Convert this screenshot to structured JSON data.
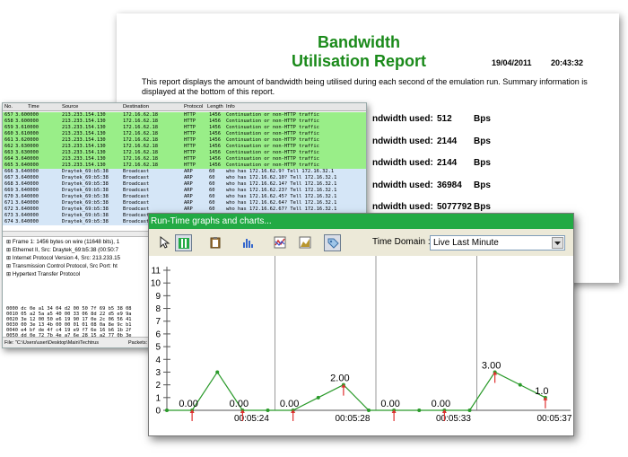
{
  "report": {
    "title_line1": "Bandwidth",
    "title_line2": "Utilisation Report",
    "date": "19/04/2011",
    "time": "20:43:32",
    "intro": "This report displays the amount of bandwidth being utilised during each second of the emulation run.  Summary information is displayed at the bottom of this report.",
    "rows": [
      {
        "label": "ndwidth used:",
        "value": "512",
        "unit": "Bps"
      },
      {
        "label": "ndwidth used:",
        "value": "2144",
        "unit": "Bps"
      },
      {
        "label": "ndwidth used:",
        "value": "2144",
        "unit": "Bps"
      },
      {
        "label": "ndwidth used:",
        "value": "36984",
        "unit": "Bps"
      },
      {
        "label": "ndwidth used:",
        "value": "5077792",
        "unit": "Bps"
      }
    ]
  },
  "capture": {
    "columns": [
      "No.",
      "Time",
      "Source",
      "Destination",
      "Protocol",
      "Length",
      "Info"
    ],
    "packets": [
      {
        "no": "657",
        "time": "3.600000",
        "src": "213.233.154.130",
        "dst": "172.16.62.18",
        "proto": "HTTP",
        "len": "1456",
        "info": "Continuation or non-HTTP traffic",
        "kind": "http"
      },
      {
        "no": "658",
        "time": "3.600000",
        "src": "213.233.154.130",
        "dst": "172.16.62.18",
        "proto": "HTTP",
        "len": "1456",
        "info": "Continuation or non-HTTP traffic",
        "kind": "http"
      },
      {
        "no": "659",
        "time": "3.610000",
        "src": "213.233.154.130",
        "dst": "172.16.62.18",
        "proto": "HTTP",
        "len": "1456",
        "info": "Continuation or non-HTTP traffic",
        "kind": "http"
      },
      {
        "no": "660",
        "time": "3.610000",
        "src": "213.233.154.130",
        "dst": "172.16.62.18",
        "proto": "HTTP",
        "len": "1456",
        "info": "Continuation or non-HTTP traffic",
        "kind": "http"
      },
      {
        "no": "661",
        "time": "3.620000",
        "src": "213.233.154.130",
        "dst": "172.16.62.18",
        "proto": "HTTP",
        "len": "1456",
        "info": "Continuation or non-HTTP traffic",
        "kind": "http"
      },
      {
        "no": "662",
        "time": "3.630000",
        "src": "213.233.154.130",
        "dst": "172.16.62.18",
        "proto": "HTTP",
        "len": "1456",
        "info": "Continuation or non-HTTP traffic",
        "kind": "http"
      },
      {
        "no": "663",
        "time": "3.630000",
        "src": "213.233.154.130",
        "dst": "172.16.62.18",
        "proto": "HTTP",
        "len": "1456",
        "info": "Continuation or non-HTTP traffic",
        "kind": "http"
      },
      {
        "no": "664",
        "time": "3.640000",
        "src": "213.233.154.130",
        "dst": "172.16.62.18",
        "proto": "HTTP",
        "len": "1456",
        "info": "Continuation or non-HTTP traffic",
        "kind": "http"
      },
      {
        "no": "665",
        "time": "3.640000",
        "src": "213.233.154.130",
        "dst": "172.16.62.18",
        "proto": "HTTP",
        "len": "1456",
        "info": "Continuation or non-HTTP traffic",
        "kind": "http"
      },
      {
        "no": "666",
        "time": "3.640000",
        "src": "Draytek_69:b5:38",
        "dst": "Broadcast",
        "proto": "ARP",
        "len": "60",
        "info": "who has 172.16.62.9?  Tell 172.16.32.1",
        "kind": "arp"
      },
      {
        "no": "667",
        "time": "3.640000",
        "src": "Draytek_69:b5:38",
        "dst": "Broadcast",
        "proto": "ARP",
        "len": "60",
        "info": "who has 172.16.62.10?  Tell 172.16.32.1",
        "kind": "arp"
      },
      {
        "no": "668",
        "time": "3.640000",
        "src": "Draytek_69:b5:38",
        "dst": "Broadcast",
        "proto": "ARP",
        "len": "60",
        "info": "who has 172.16.62.14?  Tell 172.16.32.1",
        "kind": "arp"
      },
      {
        "no": "669",
        "time": "3.640000",
        "src": "Draytek_69:b5:38",
        "dst": "Broadcast",
        "proto": "ARP",
        "len": "60",
        "info": "who has 172.16.62.23?  Tell 172.16.32.1",
        "kind": "arp"
      },
      {
        "no": "670",
        "time": "3.640000",
        "src": "Draytek_69:b5:38",
        "dst": "Broadcast",
        "proto": "ARP",
        "len": "60",
        "info": "who has 172.16.62.45?  Tell 172.16.32.1",
        "kind": "arp"
      },
      {
        "no": "671",
        "time": "3.640000",
        "src": "Draytek_69:b5:38",
        "dst": "Broadcast",
        "proto": "ARP",
        "len": "60",
        "info": "who has 172.16.62.64?  Tell 172.16.32.1",
        "kind": "arp"
      },
      {
        "no": "672",
        "time": "3.640000",
        "src": "Draytek_69:b5:38",
        "dst": "Broadcast",
        "proto": "ARP",
        "len": "60",
        "info": "who has 172.16.62.67?  Tell 172.16.32.1",
        "kind": "arp"
      },
      {
        "no": "673",
        "time": "3.640000",
        "src": "Draytek_69:b5:38",
        "dst": "Broadcast",
        "proto": "ARP",
        "len": "60",
        "info": "who has 172.16.62.",
        "kind": "arp"
      },
      {
        "no": "674",
        "time": "3.640000",
        "src": "Draytek_69:b5:38",
        "dst": "Broadcast",
        "proto": "ARP",
        "len": "60",
        "info": "who has",
        "kind": "arp"
      }
    ],
    "details": [
      "Frame 1: 1456 bytes on wire (11648 bits), 1",
      "Ethernet II, Src: Draytek_69:b5:38 (00:50:7",
      "Internet Protocol Version 4, Src: 213.233.15",
      "Transmission Control Protocol, Src Port: ht",
      "Hypertext Transfer Protocol"
    ],
    "hex": [
      "0000  dc 0e a1 34 04 d2 00 50  7f 69 b5 38 08",
      "0010  05 a2 5a a5 40 00 33 06  8d 22 d5 e9 9a",
      "0020  3e 12 00 50 e6 19 90 17  0e 2c 06 56 41",
      "0030  00 3e 13 4b 00 00 01 01  08 0a 8e 9c b1",
      "0040  e4 bf de 4f c4 19 e9 f7  6e 16 b6 1b 2f",
      "0050  dd 0e 72 7b 4e a7 6e 28  15 a2 77 0b 3e"
    ],
    "status_file": "File: \"C:\\Users\\user\\Desktop\\Main\\Techtrus",
    "status_packets": "Packets: 2983 D"
  },
  "graph": {
    "window_title": "Run-Time graphs and charts...",
    "time_domain_label": "Time Domain :",
    "time_domain_value": "Live Last Minute",
    "toolbar_icons": [
      "cursor-icon",
      "split-view-icon",
      "clipboard-icon",
      "bar-chart-icon",
      "line-chart-icon",
      "area-chart-icon",
      "tag-icon"
    ],
    "colors": {
      "titlebar": "#22aa44",
      "line": "#2a9a2a",
      "marker": "#e03030"
    }
  },
  "chart_data": {
    "type": "line",
    "title": "",
    "xlabel": "",
    "ylabel": "",
    "ylim": [
      0,
      11
    ],
    "y_ticks": [
      0,
      1,
      2,
      3,
      4,
      5,
      6,
      7,
      8,
      9,
      10,
      11
    ],
    "x_tick_labels": [
      "00:05:24",
      "00:05:28",
      "00:05:33",
      "00:05:37"
    ],
    "series": [
      {
        "x": [
          0,
          1,
          2,
          3,
          4,
          5,
          6,
          7,
          8,
          9,
          10,
          11,
          12,
          13,
          14,
          15
        ],
        "values": [
          0,
          0,
          3,
          0,
          0,
          0,
          1,
          2,
          0,
          0,
          0,
          0,
          0,
          3,
          2,
          1
        ]
      }
    ],
    "point_labels": [
      {
        "x": 1,
        "text": "0.00"
      },
      {
        "x": 3,
        "text": "0.00"
      },
      {
        "x": 5,
        "text": "0.00"
      },
      {
        "x": 7,
        "text": "2.00"
      },
      {
        "x": 9,
        "text": "0.00"
      },
      {
        "x": 11,
        "text": "0.00"
      },
      {
        "x": 13,
        "text": "3.00"
      },
      {
        "x": 15,
        "text": "1.0"
      }
    ],
    "grid": false
  }
}
